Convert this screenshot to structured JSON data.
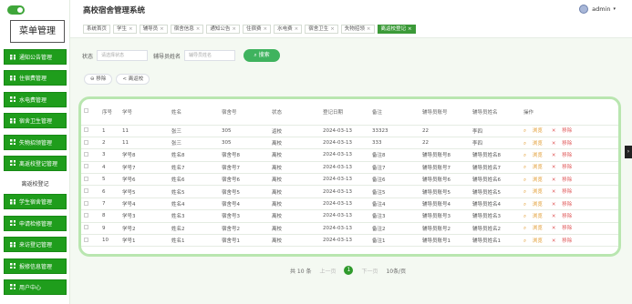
{
  "app_title": "高校宿舍管理系统",
  "user": {
    "name": "admin",
    "caret": "▾"
  },
  "sidebar": {
    "menu_title": "菜单管理",
    "items": [
      {
        "label": "通知公告管理"
      },
      {
        "label": "住宿费管理"
      },
      {
        "label": "水电费管理"
      },
      {
        "label": "宿舍卫生管理"
      },
      {
        "label": "失物招领管理"
      },
      {
        "label": "离返校登记管理"
      },
      {
        "label": "离返校登记",
        "sub": true
      },
      {
        "label": "学生宿舍管理"
      },
      {
        "label": "申请检修管理"
      },
      {
        "label": "来访登记管理"
      },
      {
        "label": "报修信息管理"
      },
      {
        "label": "用户中心"
      }
    ]
  },
  "tags": [
    {
      "label": "系统首页",
      "closable": false
    },
    {
      "label": "学生",
      "closable": true
    },
    {
      "label": "辅导员",
      "closable": true
    },
    {
      "label": "宿舍信息",
      "closable": true
    },
    {
      "label": "通知公告",
      "closable": true
    },
    {
      "label": "住宿费",
      "closable": true
    },
    {
      "label": "水电费",
      "closable": true
    },
    {
      "label": "宿舍卫生",
      "closable": true
    },
    {
      "label": "失物招领",
      "closable": true
    },
    {
      "label": "离返校登记",
      "closable": true,
      "active": true
    }
  ],
  "search": {
    "status_label": "状态",
    "status_placeholder": "请选择状态",
    "counselor_label": "辅导员姓名",
    "counselor_placeholder": "辅导员姓名",
    "search_button": "搜索"
  },
  "actions": {
    "remove": "移除",
    "return": "离返校"
  },
  "table": {
    "columns": [
      "",
      "序号",
      "学号",
      "姓名",
      "宿舍号",
      "状态",
      "登记日期",
      "备注",
      "辅导员账号",
      "辅导员姓名",
      "操作"
    ],
    "rows": [
      [
        "1",
        "11",
        "张三",
        "305",
        "返校",
        "2024-03-13",
        "33323",
        "22",
        "李四"
      ],
      [
        "2",
        "11",
        "张三",
        "305",
        "离校",
        "2024-03-13",
        "333",
        "22",
        "李四"
      ],
      [
        "3",
        "学号8",
        "姓名8",
        "宿舍号8",
        "离校",
        "2024-03-13",
        "备注8",
        "辅导员账号8",
        "辅导员姓名8"
      ],
      [
        "4",
        "学号7",
        "姓名7",
        "宿舍号7",
        "离校",
        "2024-03-13",
        "备注7",
        "辅导员账号7",
        "辅导员姓名7"
      ],
      [
        "5",
        "学号6",
        "姓名6",
        "宿舍号6",
        "离校",
        "2024-03-13",
        "备注6",
        "辅导员账号6",
        "辅导员姓名6"
      ],
      [
        "6",
        "学号5",
        "姓名5",
        "宿舍号5",
        "离校",
        "2024-03-13",
        "备注5",
        "辅导员账号5",
        "辅导员姓名5"
      ],
      [
        "7",
        "学号4",
        "姓名4",
        "宿舍号4",
        "离校",
        "2024-03-13",
        "备注4",
        "辅导员账号4",
        "辅导员姓名4"
      ],
      [
        "8",
        "学号3",
        "姓名3",
        "宿舍号3",
        "离校",
        "2024-03-13",
        "备注3",
        "辅导员账号3",
        "辅导员姓名3"
      ],
      [
        "9",
        "学号2",
        "姓名2",
        "宿舍号2",
        "离校",
        "2024-03-13",
        "备注2",
        "辅导员账号2",
        "辅导员姓名2"
      ],
      [
        "10",
        "学号1",
        "姓名1",
        "宿舍号1",
        "离校",
        "2024-03-13",
        "备注1",
        "辅导员账号1",
        "辅导员姓名1"
      ]
    ],
    "op_view": "浏览",
    "op_delete": "移除"
  },
  "pager": {
    "total": "共 10 条",
    "prev": "上一页",
    "current": "1",
    "next": "下一页",
    "page_size": "10条/页"
  },
  "colors": {
    "primary": "#1f9d1c",
    "accent": "#3fb35e",
    "panel_border": "#b9e6b0"
  }
}
